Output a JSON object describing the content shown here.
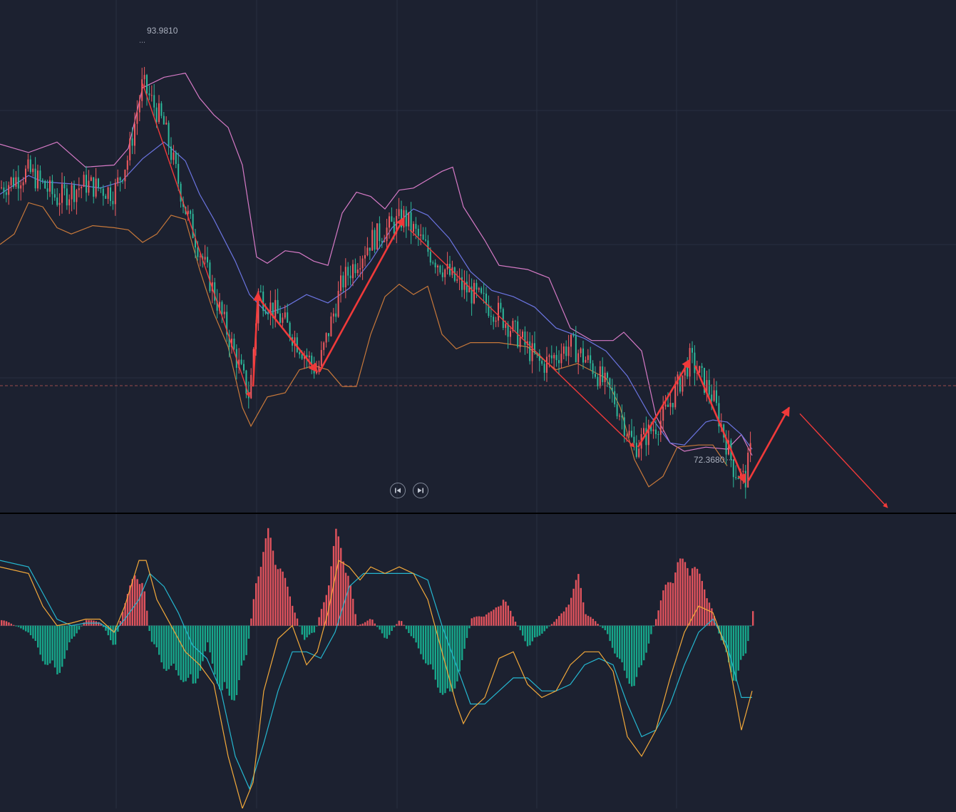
{
  "chart_data": [
    {
      "type": "candlestick",
      "panel": "price",
      "high_marker": "93.9810",
      "low_marker": "72.3680",
      "y_range": [
        71.5,
        96.0
      ],
      "x_range": [
        0,
        1341
      ],
      "grid": true,
      "colors": {
        "up": "#ef5a5f",
        "down": "#2db99b",
        "upper_band": "#d67ac6",
        "middle_band": "#6b74e0",
        "lower_band": "#c7783a",
        "arrows": "#f03a3a",
        "last_price_line": "#9c4b4b",
        "grid": "#283040"
      },
      "upper_band": [
        [
          0,
          89.1
        ],
        [
          40,
          88.7
        ],
        [
          80,
          89.2
        ],
        [
          120,
          88.0
        ],
        [
          160,
          88.1
        ],
        [
          180,
          88.9
        ],
        [
          200,
          91.8
        ],
        [
          230,
          92.3
        ],
        [
          260,
          92.5
        ],
        [
          280,
          91.3
        ],
        [
          300,
          90.5
        ],
        [
          320,
          89.9
        ],
        [
          340,
          88.1
        ],
        [
          360,
          83.7
        ],
        [
          375,
          83.4
        ],
        [
          400,
          84.0
        ],
        [
          420,
          83.9
        ],
        [
          440,
          83.5
        ],
        [
          460,
          83.3
        ],
        [
          480,
          85.8
        ],
        [
          500,
          86.8
        ],
        [
          520,
          86.6
        ],
        [
          540,
          86.0
        ],
        [
          560,
          86.9
        ],
        [
          580,
          87.0
        ],
        [
          600,
          87.4
        ],
        [
          620,
          87.8
        ],
        [
          635,
          88.0
        ],
        [
          650,
          86.1
        ],
        [
          680,
          84.5
        ],
        [
          700,
          83.3
        ],
        [
          740,
          83.1
        ],
        [
          770,
          82.7
        ],
        [
          800,
          80.3
        ],
        [
          830,
          79.7
        ],
        [
          860,
          79.7
        ],
        [
          875,
          80.1
        ],
        [
          900,
          79.2
        ],
        [
          920,
          76.1
        ],
        [
          940,
          74.8
        ],
        [
          960,
          74.4
        ],
        [
          990,
          74.6
        ],
        [
          1020,
          74.5
        ],
        [
          1040,
          75.2
        ],
        [
          1055,
          74.2
        ]
      ],
      "middle_band": [
        [
          0,
          86.7
        ],
        [
          40,
          87.6
        ],
        [
          60,
          87.3
        ],
        [
          100,
          87.2
        ],
        [
          140,
          87.0
        ],
        [
          170,
          87.3
        ],
        [
          200,
          88.4
        ],
        [
          230,
          89.2
        ],
        [
          260,
          88.3
        ],
        [
          280,
          86.7
        ],
        [
          300,
          85.5
        ],
        [
          330,
          83.5
        ],
        [
          350,
          81.9
        ],
        [
          375,
          81.0
        ],
        [
          400,
          81.3
        ],
        [
          430,
          81.9
        ],
        [
          460,
          81.5
        ],
        [
          490,
          82.2
        ],
        [
          520,
          83.5
        ],
        [
          550,
          85.1
        ],
        [
          580,
          86.0
        ],
        [
          600,
          85.7
        ],
        [
          630,
          84.6
        ],
        [
          660,
          83.0
        ],
        [
          690,
          82.1
        ],
        [
          720,
          81.8
        ],
        [
          750,
          81.3
        ],
        [
          780,
          80.3
        ],
        [
          820,
          79.8
        ],
        [
          850,
          79.2
        ],
        [
          880,
          78.0
        ],
        [
          910,
          76.2
        ],
        [
          940,
          74.8
        ],
        [
          960,
          74.7
        ],
        [
          990,
          75.8
        ],
        [
          1000,
          75.9
        ],
        [
          1020,
          75.8
        ],
        [
          1040,
          75.2
        ],
        [
          1055,
          74.5
        ]
      ],
      "lower_band": [
        [
          0,
          84.3
        ],
        [
          20,
          84.8
        ],
        [
          40,
          86.3
        ],
        [
          60,
          86.1
        ],
        [
          80,
          85.1
        ],
        [
          100,
          84.8
        ],
        [
          130,
          85.2
        ],
        [
          160,
          85.1
        ],
        [
          180,
          85.0
        ],
        [
          200,
          84.4
        ],
        [
          220,
          84.8
        ],
        [
          240,
          85.7
        ],
        [
          260,
          85.5
        ],
        [
          280,
          83.1
        ],
        [
          300,
          81.0
        ],
        [
          320,
          79.4
        ],
        [
          340,
          76.5
        ],
        [
          352,
          75.6
        ],
        [
          375,
          77.0
        ],
        [
          400,
          77.2
        ],
        [
          420,
          78.3
        ],
        [
          440,
          78.5
        ],
        [
          460,
          78.3
        ],
        [
          480,
          77.5
        ],
        [
          500,
          77.5
        ],
        [
          520,
          80.0
        ],
        [
          540,
          81.8
        ],
        [
          560,
          82.4
        ],
        [
          580,
          81.9
        ],
        [
          600,
          82.3
        ],
        [
          620,
          80.0
        ],
        [
          640,
          79.3
        ],
        [
          660,
          79.6
        ],
        [
          700,
          79.6
        ],
        [
          740,
          79.4
        ],
        [
          780,
          78.3
        ],
        [
          810,
          78.6
        ],
        [
          850,
          77.9
        ],
        [
          870,
          76.5
        ],
        [
          890,
          74.0
        ],
        [
          910,
          72.7
        ],
        [
          930,
          73.2
        ],
        [
          950,
          74.6
        ],
        [
          980,
          74.7
        ],
        [
          1000,
          74.7
        ],
        [
          1020,
          73.7
        ]
      ],
      "trend_arrows": [
        [
          [
            200,
            92.0
          ],
          [
            350,
            77.0
          ]
        ],
        [
          [
            355,
            77.5
          ],
          [
            362,
            82.0
          ]
        ],
        [
          [
            366,
            81.6
          ],
          [
            445,
            78.2
          ]
        ],
        [
          [
            448,
            78.2
          ],
          [
            567,
            85.6
          ]
        ],
        [
          [
            575,
            85.0
          ],
          [
            890,
            74.6
          ]
        ],
        [
          [
            895,
            74.6
          ],
          [
            968,
            78.8
          ]
        ],
        [
          [
            975,
            78.5
          ],
          [
            1045,
            72.9
          ]
        ],
        [
          [
            1050,
            73.0
          ],
          [
            1107,
            76.5
          ]
        ],
        [
          [
            1122,
            76.2
          ],
          [
            1245,
            71.7
          ]
        ]
      ]
    },
    {
      "type": "macd",
      "panel": "indicator",
      "y_range": [
        -1.4,
        0.85
      ],
      "zero_line": true,
      "colors": {
        "histogram_up": "#e0535d",
        "histogram_down": "#17a68a",
        "dif": "#f3a93a",
        "dea": "#25b6cf"
      },
      "histogram": [
        [
          0,
          0.05
        ],
        [
          40,
          -0.05
        ],
        [
          60,
          -0.25
        ],
        [
          80,
          -0.35
        ],
        [
          100,
          -0.1
        ],
        [
          120,
          0.05
        ],
        [
          140,
          0.02
        ],
        [
          160,
          -0.15
        ],
        [
          170,
          0.1
        ],
        [
          190,
          0.4
        ],
        [
          200,
          0.3
        ],
        [
          210,
          -0.1
        ],
        [
          230,
          -0.3
        ],
        [
          250,
          -0.35
        ],
        [
          270,
          -0.45
        ],
        [
          290,
          -0.15
        ],
        [
          310,
          -0.5
        ],
        [
          330,
          -0.5
        ],
        [
          345,
          -0.2
        ],
        [
          360,
          0.4
        ],
        [
          375,
          0.65
        ],
        [
          390,
          0.45
        ],
        [
          410,
          0.15
        ],
        [
          425,
          -0.1
        ],
        [
          440,
          -0.05
        ],
        [
          455,
          0.2
        ],
        [
          470,
          0.65
        ],
        [
          485,
          0.45
        ],
        [
          500,
          0.0
        ],
        [
          520,
          0.05
        ],
        [
          540,
          -0.1
        ],
        [
          560,
          0.05
        ],
        [
          590,
          -0.2
        ],
        [
          610,
          -0.4
        ],
        [
          630,
          -0.55
        ],
        [
          650,
          -0.2
        ],
        [
          660,
          0.05
        ],
        [
          690,
          0.1
        ],
        [
          705,
          0.2
        ],
        [
          720,
          0.05
        ],
        [
          740,
          -0.15
        ],
        [
          760,
          -0.05
        ],
        [
          790,
          0.1
        ],
        [
          810,
          0.35
        ],
        [
          820,
          0.1
        ],
        [
          850,
          -0.05
        ],
        [
          870,
          -0.3
        ],
        [
          890,
          -0.45
        ],
        [
          910,
          -0.1
        ],
        [
          930,
          0.25
        ],
        [
          950,
          0.45
        ],
        [
          970,
          0.45
        ],
        [
          990,
          0.25
        ],
        [
          1010,
          -0.1
        ],
        [
          1030,
          -0.4
        ],
        [
          1045,
          -0.2
        ],
        [
          1055,
          0.1
        ]
      ],
      "dif": [
        [
          0,
          0.45
        ],
        [
          40,
          0.4
        ],
        [
          60,
          0.15
        ],
        [
          80,
          -0.0
        ],
        [
          100,
          0.02
        ],
        [
          120,
          0.05
        ],
        [
          140,
          0.05
        ],
        [
          160,
          -0.05
        ],
        [
          175,
          0.15
        ],
        [
          195,
          0.5
        ],
        [
          205,
          0.5
        ],
        [
          220,
          0.2
        ],
        [
          240,
          0.0
        ],
        [
          260,
          -0.2
        ],
        [
          280,
          -0.3
        ],
        [
          300,
          -0.45
        ],
        [
          320,
          -1.0
        ],
        [
          340,
          -1.4
        ],
        [
          355,
          -1.2
        ],
        [
          370,
          -0.5
        ],
        [
          390,
          -0.1
        ],
        [
          410,
          0.0
        ],
        [
          430,
          -0.3
        ],
        [
          445,
          -0.2
        ],
        [
          460,
          0.1
        ],
        [
          475,
          0.5
        ],
        [
          490,
          0.45
        ],
        [
          505,
          0.35
        ],
        [
          520,
          0.45
        ],
        [
          540,
          0.4
        ],
        [
          560,
          0.45
        ],
        [
          580,
          0.4
        ],
        [
          600,
          0.2
        ],
        [
          620,
          -0.2
        ],
        [
          640,
          -0.6
        ],
        [
          650,
          -0.75
        ],
        [
          660,
          -0.65
        ],
        [
          680,
          -0.55
        ],
        [
          700,
          -0.25
        ],
        [
          720,
          -0.2
        ],
        [
          740,
          -0.45
        ],
        [
          760,
          -0.55
        ],
        [
          780,
          -0.5
        ],
        [
          800,
          -0.3
        ],
        [
          820,
          -0.2
        ],
        [
          840,
          -0.2
        ],
        [
          860,
          -0.35
        ],
        [
          880,
          -0.85
        ],
        [
          900,
          -1.0
        ],
        [
          920,
          -0.8
        ],
        [
          940,
          -0.4
        ],
        [
          960,
          -0.05
        ],
        [
          980,
          0.15
        ],
        [
          1000,
          0.1
        ],
        [
          1020,
          -0.2
        ],
        [
          1040,
          -0.8
        ],
        [
          1055,
          -0.5
        ]
      ],
      "dea": [
        [
          0,
          0.5
        ],
        [
          40,
          0.45
        ],
        [
          60,
          0.25
        ],
        [
          80,
          0.05
        ],
        [
          100,
          0.0
        ],
        [
          120,
          0.02
        ],
        [
          140,
          0.02
        ],
        [
          160,
          -0.05
        ],
        [
          175,
          0.05
        ],
        [
          195,
          0.2
        ],
        [
          210,
          0.4
        ],
        [
          230,
          0.3
        ],
        [
          250,
          0.1
        ],
        [
          270,
          -0.15
        ],
        [
          290,
          -0.25
        ],
        [
          310,
          -0.5
        ],
        [
          330,
          -1.0
        ],
        [
          350,
          -1.25
        ],
        [
          370,
          -0.9
        ],
        [
          390,
          -0.5
        ],
        [
          410,
          -0.2
        ],
        [
          430,
          -0.2
        ],
        [
          450,
          -0.25
        ],
        [
          470,
          -0.05
        ],
        [
          490,
          0.3
        ],
        [
          510,
          0.4
        ],
        [
          530,
          0.4
        ],
        [
          560,
          0.4
        ],
        [
          580,
          0.4
        ],
        [
          600,
          0.35
        ],
        [
          620,
          0.0
        ],
        [
          640,
          -0.3
        ],
        [
          660,
          -0.6
        ],
        [
          680,
          -0.6
        ],
        [
          700,
          -0.5
        ],
        [
          720,
          -0.4
        ],
        [
          740,
          -0.4
        ],
        [
          760,
          -0.5
        ],
        [
          780,
          -0.5
        ],
        [
          800,
          -0.45
        ],
        [
          820,
          -0.3
        ],
        [
          840,
          -0.25
        ],
        [
          860,
          -0.3
        ],
        [
          880,
          -0.6
        ],
        [
          900,
          -0.85
        ],
        [
          920,
          -0.8
        ],
        [
          940,
          -0.6
        ],
        [
          960,
          -0.3
        ],
        [
          980,
          -0.05
        ],
        [
          1000,
          0.05
        ],
        [
          1020,
          -0.15
        ],
        [
          1040,
          -0.55
        ],
        [
          1055,
          -0.55
        ]
      ]
    }
  ]
}
